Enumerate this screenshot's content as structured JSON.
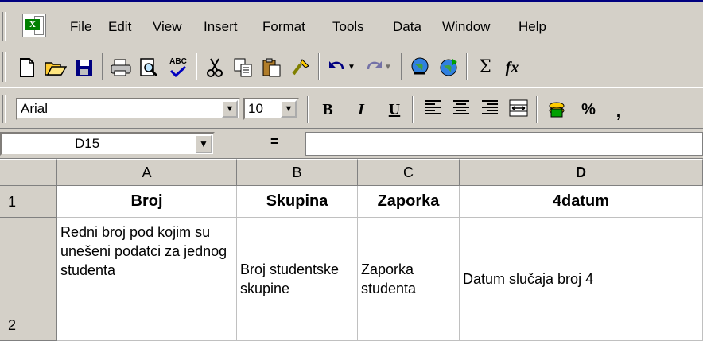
{
  "menu": {
    "items": [
      "File",
      "Edit",
      "View",
      "Insert",
      "Format",
      "Tools",
      "Data",
      "Window",
      "Help"
    ]
  },
  "toolbar": {
    "icons": [
      "new-icon",
      "open-icon",
      "save-icon",
      "print-icon",
      "print-preview-icon",
      "spelling-icon",
      "cut-icon",
      "copy-icon",
      "paste-icon",
      "format-painter-icon",
      "undo-icon",
      "redo-icon",
      "insert-hyperlink-icon",
      "web-toolbar-icon",
      "autosum-icon",
      "paste-function-icon"
    ],
    "spelling_glyph": "ABC",
    "autosum_glyph": "Σ",
    "function_glyph": "fx"
  },
  "format_toolbar": {
    "font": "Arial",
    "size": "10",
    "bold": "B",
    "italic": "I",
    "underline": "U",
    "percent": "%",
    "comma": ","
  },
  "formula_bar": {
    "name_box": "D15",
    "equals": "=",
    "formula": ""
  },
  "grid": {
    "columns": [
      "A",
      "B",
      "C",
      "D"
    ],
    "rows": [
      {
        "number": "1",
        "cells": [
          "Broj",
          "Skupina",
          "Zaporka",
          "4datum"
        ]
      },
      {
        "number": "2",
        "cells": [
          "Redni broj pod kojim su unešeni podatci za jednog studenta",
          "Broj studentske skupine",
          "Zaporka studenta",
          "Datum slučaja broj 4"
        ]
      }
    ]
  },
  "colors": {
    "chrome": "#d4d0c8",
    "title_accent": "#000080"
  }
}
